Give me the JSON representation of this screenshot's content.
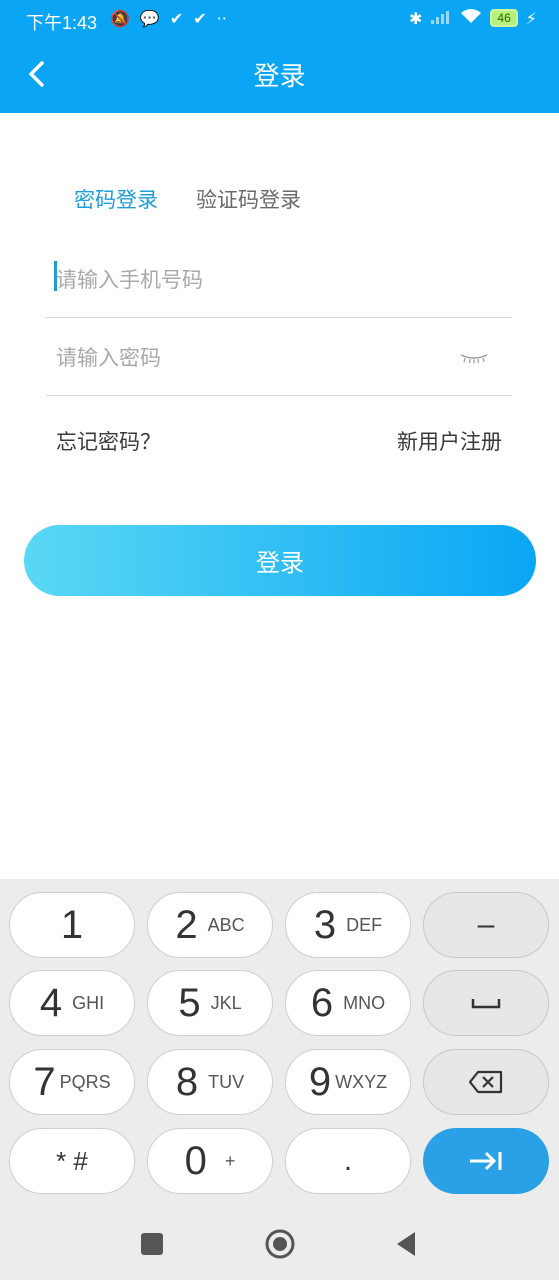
{
  "status_bar": {
    "time": "下午1:43",
    "battery_level": "46",
    "icons_left": [
      "mute-icon",
      "chat-icon",
      "task-check-icon",
      "task-check-icon",
      "more-dots-icon"
    ],
    "icons_right": [
      "bluetooth-icon",
      "signal-icon",
      "wifi-icon",
      "battery-icon",
      "charging-icon"
    ]
  },
  "header": {
    "title": "登录"
  },
  "tabs": [
    {
      "label": "密码登录",
      "active": true
    },
    {
      "label": "验证码登录",
      "active": false
    }
  ],
  "phone_input": {
    "placeholder": "请输入手机号码",
    "value": ""
  },
  "password_input": {
    "placeholder": "请输入密码",
    "value": ""
  },
  "links": {
    "forgot": "忘记密码？",
    "register": "新用户注册"
  },
  "login_button": {
    "label": "登录"
  },
  "colors": {
    "brand": "#0aa6f5",
    "accent": "#1e9ed8",
    "enter_key": "#2aa1e6"
  },
  "keyboard": {
    "rows": [
      [
        {
          "num": "1",
          "sub": ""
        },
        {
          "num": "2",
          "sub": "ABC"
        },
        {
          "num": "3",
          "sub": "DEF"
        },
        {
          "num": "–",
          "sub": ""
        }
      ],
      [
        {
          "num": "4",
          "sub": "GHI"
        },
        {
          "num": "5",
          "sub": "JKL"
        },
        {
          "num": "6",
          "sub": "MNO"
        },
        {
          "num": "␣",
          "sub": ""
        }
      ],
      [
        {
          "num": "7",
          "sub": "PQRS"
        },
        {
          "num": "8",
          "sub": "TUV"
        },
        {
          "num": "9",
          "sub": "WXYZ"
        },
        {
          "num": "",
          "sub": ""
        }
      ],
      [
        {
          "num": "* #",
          "sub": ""
        },
        {
          "num": "0",
          "sub": "+"
        },
        {
          "num": ".",
          "sub": ""
        },
        {
          "num": "",
          "sub": ""
        }
      ]
    ]
  }
}
